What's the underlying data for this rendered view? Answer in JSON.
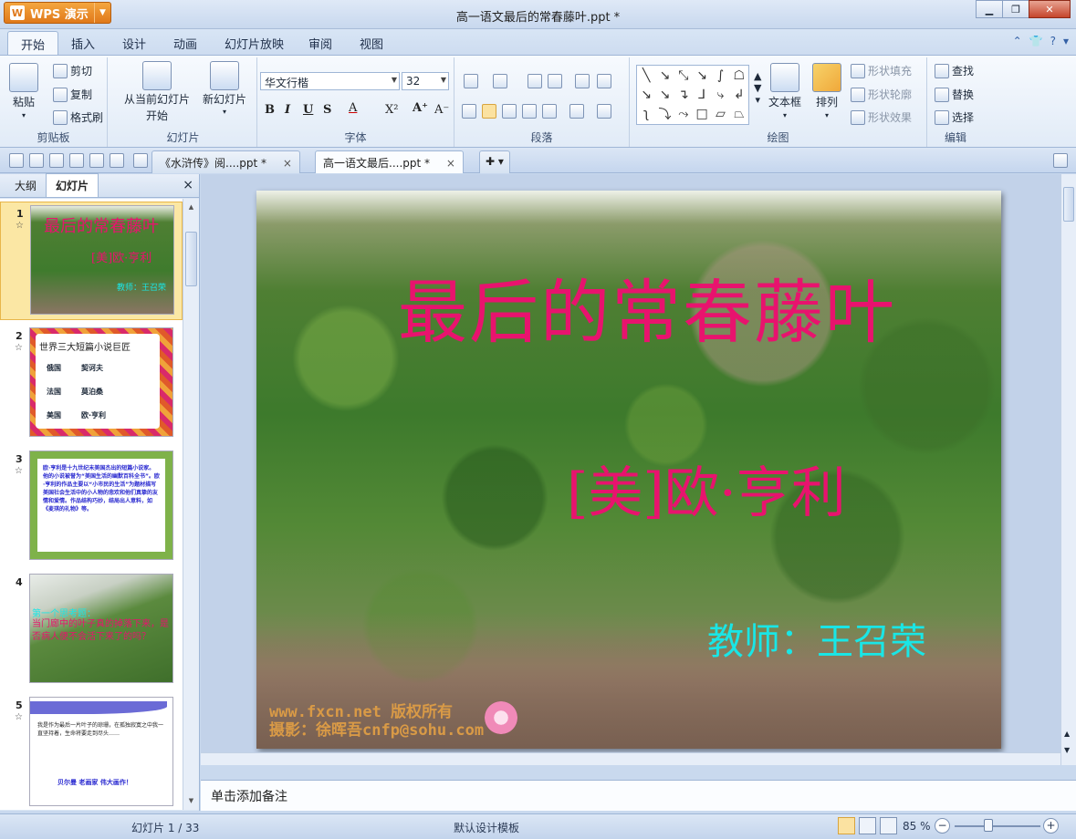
{
  "window": {
    "app_button": "WPS 演示",
    "title": "高一语文最后的常春藤叶.ppt *"
  },
  "menu": {
    "tabs": [
      "开始",
      "插入",
      "设计",
      "动画",
      "幻灯片放映",
      "审阅",
      "视图"
    ],
    "active": "开始"
  },
  "ribbon": {
    "clipboard": {
      "paste": "粘贴",
      "cut": "剪切",
      "copy": "复制",
      "format_painter": "格式刷",
      "label": "剪贴板"
    },
    "slides": {
      "from_current_l1": "从当前幻灯片",
      "from_current_l2": "开始",
      "new_slide": "新幻灯片",
      "label": "幻灯片"
    },
    "font": {
      "family": "华文行楷",
      "size": "32",
      "bold": "B",
      "italic": "I",
      "underline": "U",
      "shadow": "S",
      "color": "A",
      "superscript": "X²",
      "grow": "A⁺",
      "shrink": "A⁻",
      "label": "字体"
    },
    "paragraph": {
      "label": "段落"
    },
    "drawing": {
      "textbox": "文本框",
      "arrange": "排列",
      "shape_fill": "形状填充",
      "shape_outline": "形状轮廓",
      "shape_effect": "形状效果",
      "label": "绘图"
    },
    "edit": {
      "find": "查找",
      "replace": "替换",
      "select": "选择",
      "label": "编辑"
    }
  },
  "doc_tabs": [
    {
      "label": "《水浒传》阅....ppt *",
      "close": "×"
    },
    {
      "label": "高一语文最后....ppt *",
      "close": "×"
    }
  ],
  "left_pane": {
    "tabs": [
      "大纲",
      "幻灯片"
    ],
    "active": "幻灯片",
    "close": "×",
    "thumbnails": [
      {
        "num": "1",
        "title": "最后的常春藤叶",
        "author": "[美]欧·亨利",
        "teacher": "教师：王召荣"
      },
      {
        "num": "2",
        "heading": "世界三大短篇小说巨匠",
        "rows": [
          [
            "俄国",
            "契诃夫"
          ],
          [
            "法国",
            "莫泊桑"
          ],
          [
            "美国",
            "欧·亨利"
          ]
        ]
      },
      {
        "num": "3",
        "text": "欧·亨利是十九世纪末美国杰出的短篇小说家。他的小说被誉为“美国生活的幽默百科全书”。欧·亨利的作品主要以“小市民的生活”为题材描写美国社会生活中的小人物的悲欢和他们真挚的友情和爱情。作品结构巧妙，结局出人意料，如《麦琪的礼物》等。"
      },
      {
        "num": "4",
        "question_title": "第一个思考题：",
        "question": "当门廊中的叶子真的掉落下来，是否病人便不会活下来了的吗？"
      },
      {
        "num": "5",
        "text": "我是作为最后一片叶子的琼珊，在孤独寂寞之中我一直坚持着，生命将要走到尽头……",
        "footer": "贝尔曼 老画家 伟大画作！"
      }
    ]
  },
  "slide": {
    "title": "最后的常春藤叶",
    "author": "[美]欧·亨利",
    "teacher": "教师：王召荣",
    "watermark_line1": "www.fxcn.net 版权所有",
    "watermark_line2": "摄影：徐晖吾cnfp@sohu.com"
  },
  "notes_placeholder": "单击添加备注",
  "status": {
    "slide_counter": "幻灯片 1 / 33",
    "template": "默认设计模板",
    "zoom": "85 %",
    "zoom_minus": "−",
    "zoom_plus": "+"
  },
  "colors": {
    "slide_title": "#e8136e",
    "slide_teacher": "#19e6e6",
    "app_orange": "#e0791a"
  }
}
